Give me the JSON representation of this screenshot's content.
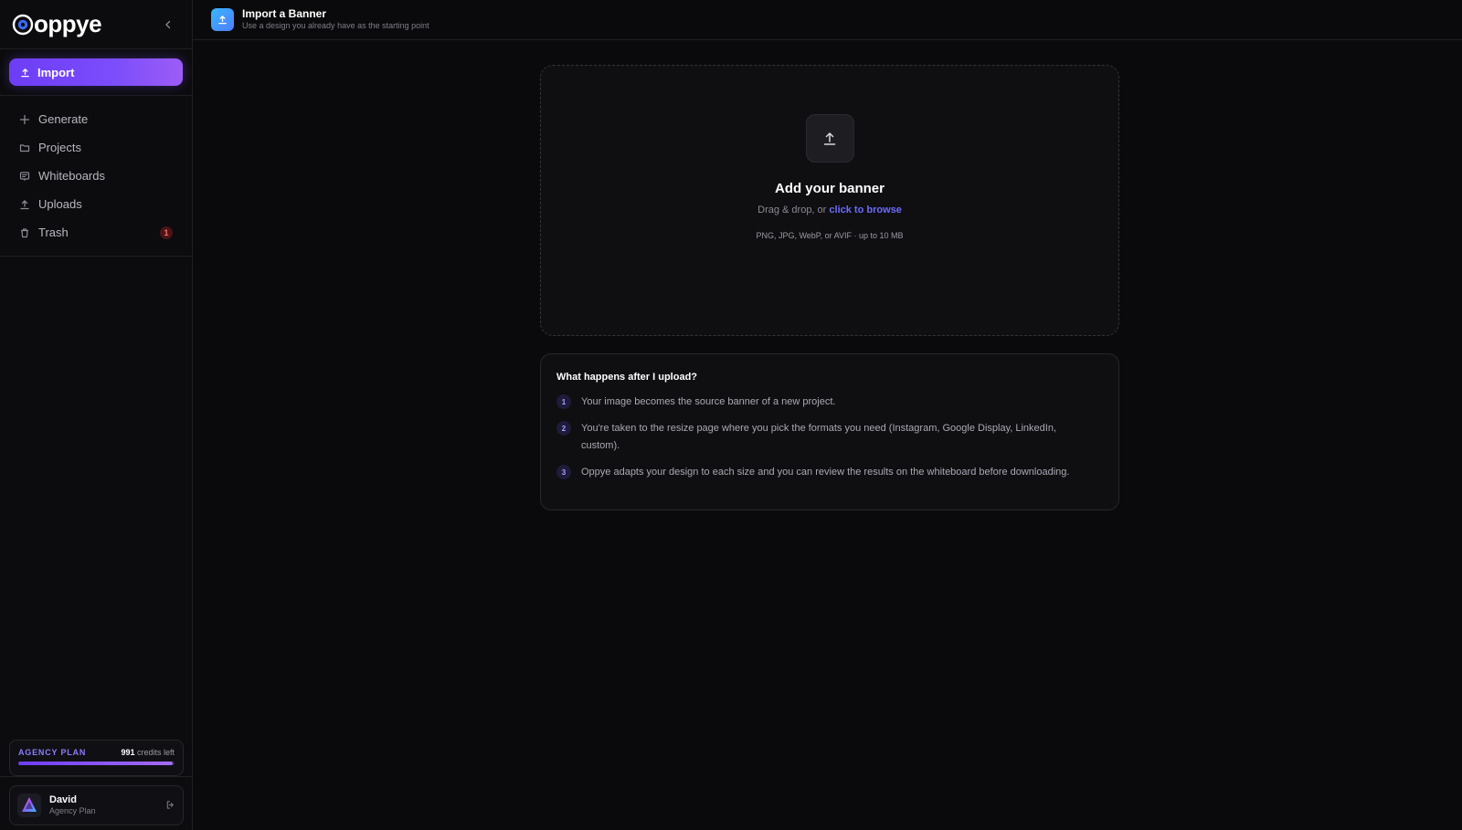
{
  "app": {
    "name": "oppye"
  },
  "sidebar": {
    "import_label": "Import",
    "items": [
      {
        "label": "Generate",
        "icon": "plus-icon"
      },
      {
        "label": "Projects",
        "icon": "folder-icon"
      },
      {
        "label": "Whiteboards",
        "icon": "whiteboard-icon"
      },
      {
        "label": "Uploads",
        "icon": "upload-icon"
      },
      {
        "label": "Trash",
        "icon": "trash-icon",
        "badge": "1"
      }
    ],
    "plan": {
      "name": "AGENCY PLAN",
      "credits": "991",
      "credits_suffix": "credits left",
      "usage_fraction": 0.99
    },
    "user": {
      "name": "David",
      "plan": "Agency Plan"
    }
  },
  "header": {
    "title": "Import a Banner",
    "subtitle": "Use a design you already have as the starting point"
  },
  "dropzone": {
    "title": "Add your banner",
    "prompt": "Drag & drop, or",
    "browse_link": "click to browse",
    "formats": "PNG, JPG, WebP, or AVIF · up to 10 MB"
  },
  "info": {
    "title": "What happens after I upload?",
    "steps": [
      {
        "num": "1",
        "text": "Your image becomes the source banner of a new project."
      },
      {
        "num": "2",
        "text": "You're taken to the resize page where you pick the formats you need (Instagram, Google Display, LinkedIn, custom)."
      },
      {
        "num": "3",
        "text": "Oppye adapts your design to each size and you can review the results on the whiteboard before downloading."
      }
    ]
  },
  "colors": {
    "accent": "#7b4dfb",
    "link": "#6b6bff",
    "background": "#0a0a0c"
  }
}
